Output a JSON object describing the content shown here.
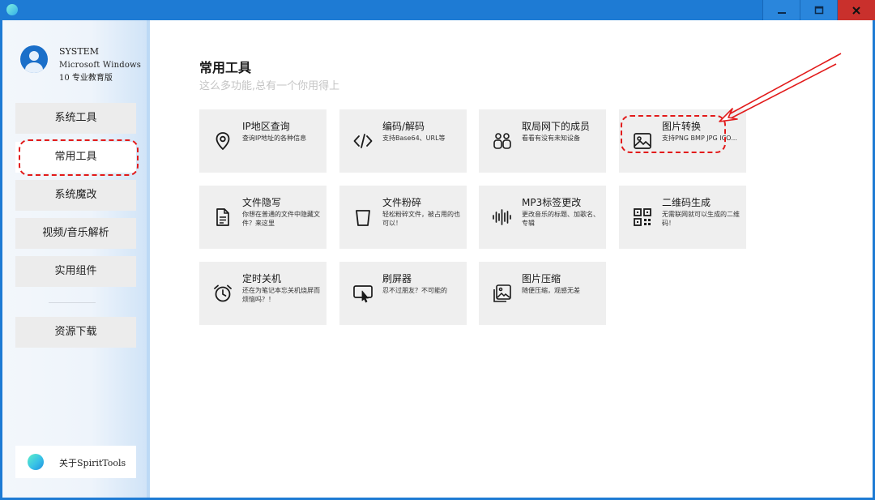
{
  "window": {
    "buttons": {
      "minimize": "—",
      "maximize": "☐",
      "close": "✕"
    }
  },
  "user": {
    "name": "SYSTEM",
    "os_line1": "Microsoft Windows",
    "os_line2": "10 专业教育版"
  },
  "sidebar": {
    "items": [
      {
        "label": "系统工具"
      },
      {
        "label": "常用工具"
      },
      {
        "label": "系统魔改"
      },
      {
        "label": "视频/音乐解析"
      },
      {
        "label": "实用组件"
      },
      {
        "label": "资源下载"
      }
    ],
    "active_index": 1,
    "about_label": "关于SpiritTools"
  },
  "main": {
    "title": "常用工具",
    "subtitle": "这么多功能,总有一个你用得上",
    "tools": [
      {
        "title": "IP地区查询",
        "desc": "查询IP地址的各种信息",
        "icon": "location-pin-icon"
      },
      {
        "title": "编码/解码",
        "desc": "支持Base64、URL等",
        "icon": "code-icon"
      },
      {
        "title": "取局网下的成员",
        "desc": "看看有没有未知设备",
        "icon": "users-icon"
      },
      {
        "title": "图片转换",
        "desc": "支持PNG BMP JPG ICO...",
        "icon": "image-icon"
      },
      {
        "title": "文件隐写",
        "desc": "你想在普通的文件中隐藏文件？来这里",
        "icon": "document-icon"
      },
      {
        "title": "文件粉碎",
        "desc": "轻松粉碎文件，被占用的也可以！",
        "icon": "trash-icon"
      },
      {
        "title": "MP3标签更改",
        "desc": "更改音乐的标题、加歌名、专辑",
        "icon": "audio-wave-icon"
      },
      {
        "title": "二维码生成",
        "desc": "无需联网就可以生成的二维码！",
        "icon": "qr-code-icon"
      },
      {
        "title": "定时关机",
        "desc": "还在为笔记本忘关机烧屏而烦恼吗？！",
        "icon": "alarm-clock-icon"
      },
      {
        "title": "刷屏器",
        "desc": "忍不过朋友？不可能的",
        "icon": "touch-screen-icon"
      },
      {
        "title": "图片压缩",
        "desc": "随便压缩，观感无差",
        "icon": "image-compress-icon"
      }
    ]
  },
  "colors": {
    "titlebar": "#1e7bd4",
    "close_button": "#c9302c",
    "annotation": "#e21a1a",
    "tile_bg": "#efefef",
    "nav_bg": "#ececec"
  }
}
